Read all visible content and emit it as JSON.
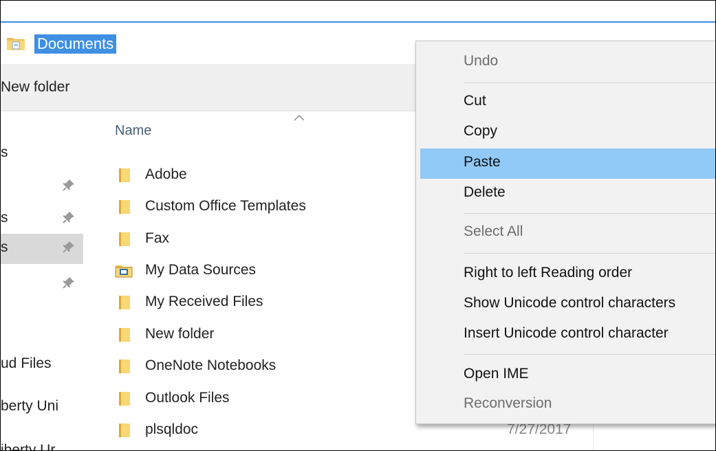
{
  "address_bar": {
    "folder_name": "Documents"
  },
  "ribbon": {
    "new_folder_label": "New folder"
  },
  "nav_pane": {
    "items": [
      {
        "label": "s",
        "pinned": false
      },
      {
        "label": "",
        "pinned": true
      },
      {
        "label": "s",
        "pinned": true
      },
      {
        "label": "s",
        "pinned": true,
        "selected": true
      },
      {
        "label": "",
        "pinned": true
      },
      {
        "label": "ud Files",
        "pinned": false
      },
      {
        "label": "berty Uni",
        "pinned": false
      },
      {
        "label": "iberty Ur",
        "pinned": false
      }
    ]
  },
  "file_list": {
    "column_name": "Name",
    "sort_direction": "ascending",
    "rows": [
      {
        "name": "Adobe",
        "icon": "folder-icon",
        "date": ""
      },
      {
        "name": "Custom Office Templates",
        "icon": "folder-icon",
        "date": ""
      },
      {
        "name": "Fax",
        "icon": "folder-icon",
        "date": ""
      },
      {
        "name": "My Data Sources",
        "icon": "data-sources-folder-icon",
        "date": ""
      },
      {
        "name": "My Received Files",
        "icon": "folder-icon",
        "date": ""
      },
      {
        "name": "New folder",
        "icon": "folder-icon",
        "date": ""
      },
      {
        "name": "OneNote Notebooks",
        "icon": "folder-icon",
        "date": ""
      },
      {
        "name": "Outlook Files",
        "icon": "folder-icon",
        "date": ""
      },
      {
        "name": "plsqldoc",
        "icon": "folder-icon",
        "date": "7/27/2017"
      }
    ]
  },
  "context_menu": {
    "undo": "Undo",
    "cut": "Cut",
    "copy": "Copy",
    "paste": "Paste",
    "delete": "Delete",
    "select_all": "Select All",
    "rtl_reading_order": "Right to left Reading order",
    "show_unicode": "Show Unicode control characters",
    "insert_unicode": "Insert Unicode control character",
    "open_ime": "Open IME",
    "reconversion": "Reconversion"
  },
  "colors": {
    "selection_blue": "#3f8fe3",
    "menu_hover": "#91c9f7",
    "folder_yellow": "#f8d775",
    "menu_background": "#f2f2f2"
  }
}
